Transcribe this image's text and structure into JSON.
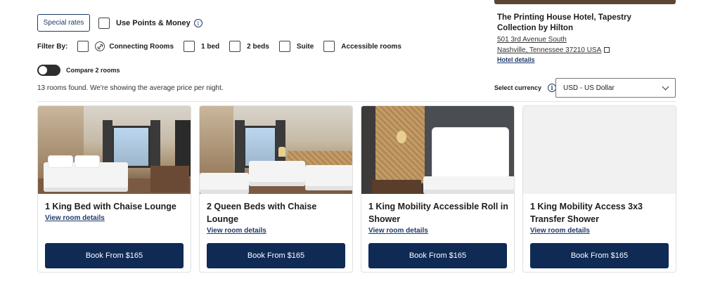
{
  "filters": {
    "special_rates": "Special rates",
    "use_points": "Use Points & Money",
    "filter_by": "Filter By:",
    "options": [
      "Connecting Rooms",
      "1 bed",
      "2 beds",
      "Suite",
      "Accessible rooms"
    ],
    "compare": "Compare 2 rooms",
    "found": "13 rooms found. We're showing the average price per night."
  },
  "hotel": {
    "name": "The Printing House Hotel, Tapestry Collection by Hilton",
    "address_line1": "501 3rd Avenue South",
    "address_line2": "Nashville, Tennessee 37210 USA",
    "details_link": "Hotel details"
  },
  "currency": {
    "label": "Select currency",
    "value": "USD - US Dollar"
  },
  "rooms": [
    {
      "title": "1 King Bed with Chaise Lounge",
      "details": "View room details",
      "book": "Book From $165"
    },
    {
      "title": "2 Queen Beds with Chaise Lounge",
      "details": "View room details",
      "book": "Book From $165"
    },
    {
      "title": "1 King Mobility Accessible Roll in Shower",
      "details": "View room details",
      "book": "Book From $165"
    },
    {
      "title": "1 King Mobility Access 3x3 Transfer Shower",
      "details": "View room details",
      "book": "Book From $165"
    }
  ],
  "icons": {
    "info": "info-icon",
    "link": "link-icon",
    "external": "external-link-icon",
    "chevron": "chevron-down-icon"
  },
  "colors": {
    "brand_navy": "#0f2a55",
    "link_blue": "#1f3b6b"
  }
}
